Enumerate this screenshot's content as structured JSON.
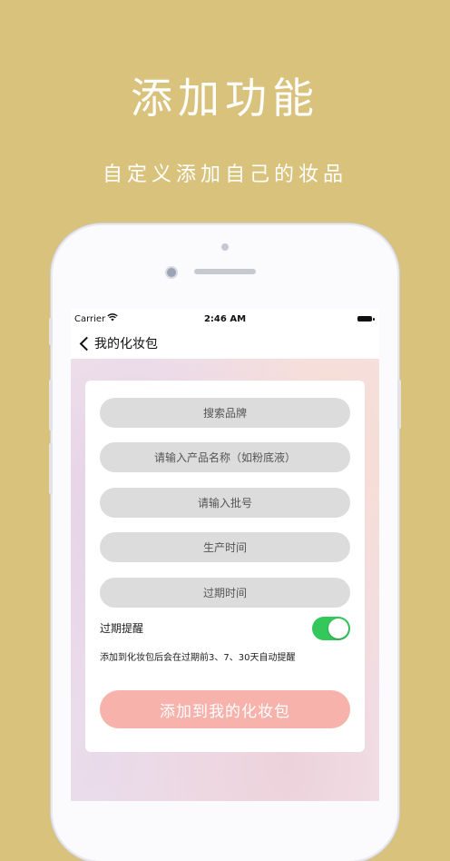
{
  "promo": {
    "title": "添加功能",
    "subtitle": "自定义添加自己的妆品"
  },
  "statusbar": {
    "carrier": "Carrier",
    "time": "2:46 AM"
  },
  "navbar": {
    "back_label": "我的化妆包"
  },
  "form": {
    "brand_placeholder": "搜索品牌",
    "product_placeholder": "请输入产品名称（如粉底液）",
    "batch_placeholder": "请输入批号",
    "production_date_placeholder": "生产时间",
    "expiry_date_placeholder": "过期时间",
    "reminder_label": "过期提醒",
    "reminder_enabled": true,
    "reminder_hint": "添加到化妆包后会在过期前3、7、30天自动提醒",
    "submit_label": "添加到我的化妆包"
  },
  "colors": {
    "background": "#d8c27c",
    "toggle_on": "#34c759",
    "submit_button": "#f8b2ac"
  }
}
